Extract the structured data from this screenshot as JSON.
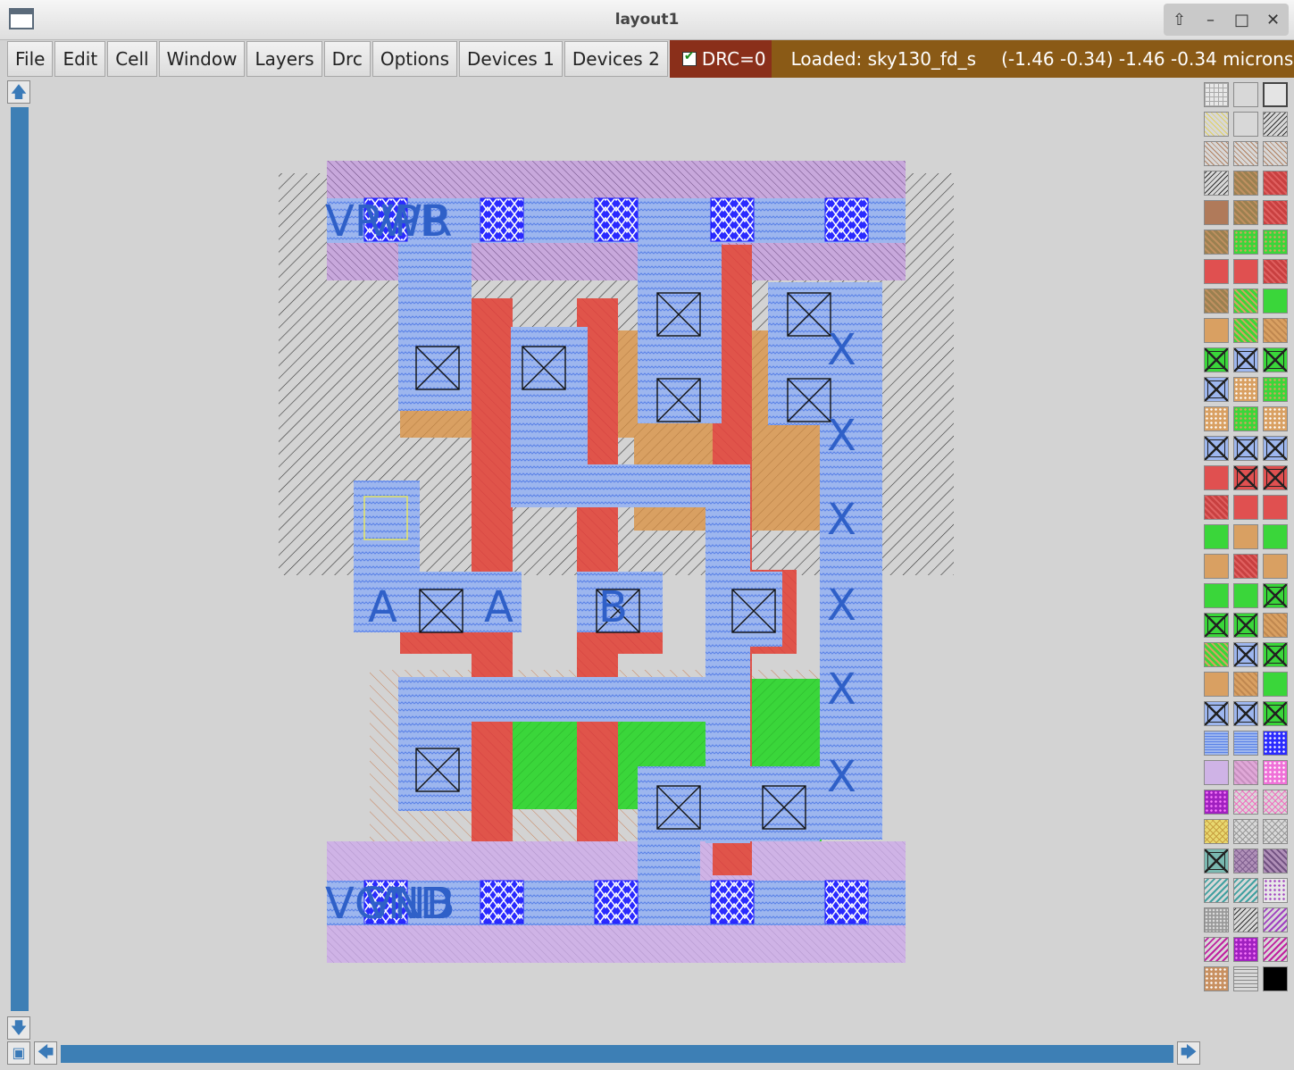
{
  "window": {
    "title": "layout1"
  },
  "menu": {
    "items": [
      "File",
      "Edit",
      "Cell",
      "Window",
      "Layers",
      "Drc",
      "Options",
      "Devices 1",
      "Devices 2"
    ]
  },
  "drc": {
    "label": "DRC=0",
    "checked": true
  },
  "status": {
    "loaded": "Loaded: sky130_fd_s",
    "coords": "(-1.46 -0.34) -1.46 -0.34 microns"
  },
  "labels": {
    "vpwr": "VPWR",
    "vpb": "VPB",
    "vgnd": "VGND",
    "vnb": "VNB",
    "a": "A",
    "b": "B",
    "x": "X"
  },
  "palette": {
    "columns": 3,
    "swatches": [
      "grid",
      "blank",
      "outline",
      "diag-yellow",
      "blank",
      "diag-black",
      "diag-brown",
      "diag-brown",
      "diag-brown",
      "diag-black",
      "hatch-brown",
      "hatch-red",
      "solid-brown",
      "hatch-brown",
      "hatch-red",
      "hatch-brown",
      "dots-green",
      "dots-green",
      "solid-red",
      "solid-red",
      "hatch-red",
      "hatch-brown",
      "hatch-green",
      "solid-green",
      "solid-tan",
      "hatch-green",
      "hatch-tan",
      "contact-green",
      "contact-blue",
      "contact-green",
      "contact-blue",
      "dots-tan",
      "dots-green",
      "dots-tan",
      "dots-green",
      "dots-tan",
      "contact-blue",
      "contact-blue",
      "contact-blue",
      "solid-red",
      "contact-red",
      "contact-red",
      "hatch-red",
      "solid-red",
      "solid-red",
      "solid-green",
      "solid-tan",
      "solid-green",
      "solid-tan",
      "hatch-red",
      "solid-tan",
      "solid-green",
      "solid-green",
      "contact-green",
      "contact-green",
      "contact-green",
      "hatch-tan",
      "hatch-green",
      "contact-blue",
      "contact-green",
      "solid-tan",
      "hatch-tan",
      "solid-green",
      "contact-blue",
      "contact-blue",
      "contact-green",
      "wave-blue",
      "wave-blue",
      "mesh-blue",
      "solid-lilac",
      "hatch-pink",
      "mesh-pink",
      "dots-purple",
      "cross-pink",
      "cross-pink",
      "cross-yellow",
      "cross-grey",
      "cross-grey",
      "contact-teal",
      "cross-violet",
      "hatch-violet",
      "diag-teal",
      "diag-teal",
      "dots-violet",
      "mesh-grey",
      "diag-black",
      "diag-purple",
      "diag-magenta",
      "dots-purple",
      "diag-magenta",
      "mesh-tan",
      "lines-grey",
      "solid-black"
    ]
  }
}
